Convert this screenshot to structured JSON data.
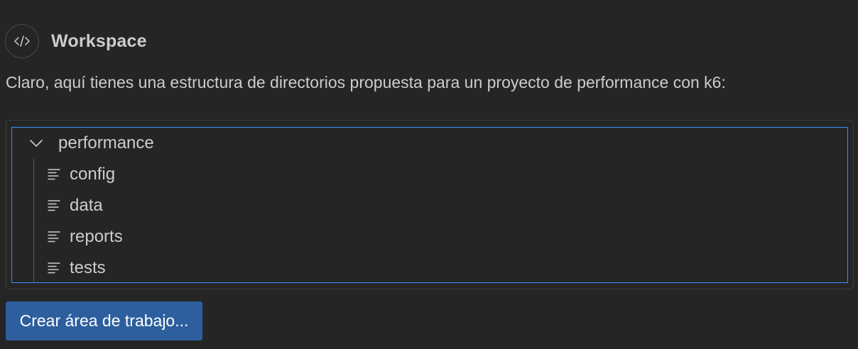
{
  "header": {
    "avatar_icon": "code-brackets-icon",
    "title": "Workspace"
  },
  "message": "Claro, aquí tienes una estructura de directorios propuesta para un proyecto de performance con k6:",
  "tree": {
    "root": {
      "label": "performance",
      "icon": "chevron-down-icon",
      "expanded": true
    },
    "children": [
      {
        "label": "config",
        "icon": "file-text-icon"
      },
      {
        "label": "data",
        "icon": "file-text-icon"
      },
      {
        "label": "reports",
        "icon": "file-text-icon"
      },
      {
        "label": "tests",
        "icon": "file-text-icon"
      }
    ]
  },
  "button": {
    "label": "Crear área de trabajo..."
  },
  "colors": {
    "background": "#252526",
    "focus_border": "#3794ff",
    "button": "#2d5f9e"
  }
}
